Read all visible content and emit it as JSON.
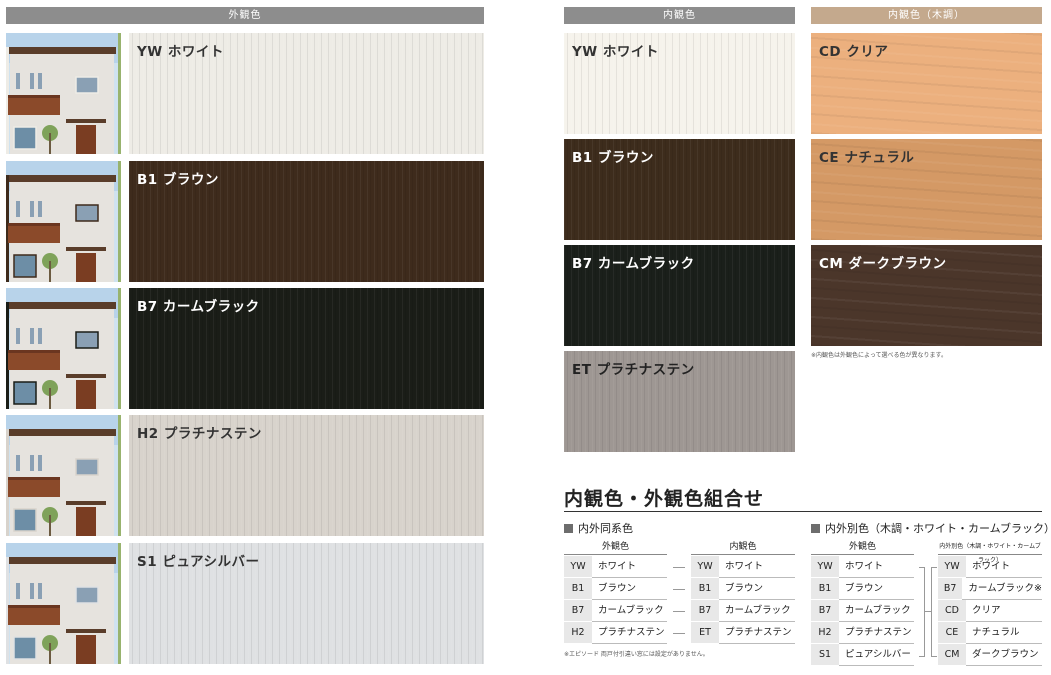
{
  "headers": {
    "exterior": "外観色",
    "interior": "内観色",
    "interior_wood": "内観色（木調）"
  },
  "exterior_swatches": [
    {
      "label": "YW ホワイト",
      "color": "#eeece6",
      "text_color": "#333333"
    },
    {
      "label": "B1 ブラウン",
      "color": "#3e2b1c",
      "text_color": "#ffffff"
    },
    {
      "label": "B7 カームブラック",
      "color": "#1a1d17",
      "text_color": "#ffffff"
    },
    {
      "label": "H2 プラチナステン",
      "color": "#d8d3cc",
      "text_color": "#333333"
    },
    {
      "label": "S1 ピュアシルバー",
      "color": "#dfe1e3",
      "text_color": "#333333"
    }
  ],
  "interior_swatches": [
    {
      "label": "YW ホワイト",
      "color": "#f6f3ec",
      "text_color": "#333333"
    },
    {
      "label": "B1 ブラウン",
      "color": "#3d2c1c",
      "text_color": "#ffffff"
    },
    {
      "label": "B7 カームブラック",
      "color": "#1a1f1a",
      "text_color": "#ffffff"
    },
    {
      "label": "ET プラチナステン",
      "color": "#9e9793",
      "text_color": "#222222"
    }
  ],
  "wood_swatches": [
    {
      "label": "CD クリア",
      "color": "#ecb07e",
      "text_color": "#333333"
    },
    {
      "label": "CE ナチュラル",
      "color": "#d49965",
      "text_color": "#333333"
    },
    {
      "label": "CM ダークブラウン",
      "color": "#4b362a",
      "text_color": "#ffffff"
    }
  ],
  "wood_note": "※内観色は外観色によって選べる色が異なります。",
  "combination": {
    "title": "内観色・外観色組合せ",
    "same_system": {
      "title": "内外同系色",
      "col_exterior": "外観色",
      "col_interior": "内観色",
      "exterior_rows": [
        {
          "code": "YW",
          "name": "ホワイト"
        },
        {
          "code": "B1",
          "name": "ブラウン"
        },
        {
          "code": "B7",
          "name": "カームブラック"
        },
        {
          "code": "H2",
          "name": "プラチナステン"
        }
      ],
      "interior_rows": [
        {
          "code": "YW",
          "name": "ホワイト"
        },
        {
          "code": "B1",
          "name": "ブラウン"
        },
        {
          "code": "B7",
          "name": "カームブラック"
        },
        {
          "code": "ET",
          "name": "プラチナステン"
        }
      ],
      "note": "※エピソード 両戸付引違い窓には設定がありません。"
    },
    "different": {
      "title": "内外別色（木調・ホワイト・カームブラック）",
      "col_exterior": "外観色",
      "col_interior": "内外別色（木調・ホワイト・カームブラック）",
      "exterior_rows": [
        {
          "code": "YW",
          "name": "ホワイト"
        },
        {
          "code": "B1",
          "name": "ブラウン"
        },
        {
          "code": "B7",
          "name": "カームブラック"
        },
        {
          "code": "H2",
          "name": "プラチナステン"
        },
        {
          "code": "S1",
          "name": "ピュアシルバー"
        }
      ],
      "interior_rows": [
        {
          "code": "YW",
          "name": "ホワイト"
        },
        {
          "code": "B7",
          "name": "カームブラック※"
        },
        {
          "code": "CD",
          "name": "クリア"
        },
        {
          "code": "CE",
          "name": "ナチュラル"
        },
        {
          "code": "CM",
          "name": "ダークブラウン"
        }
      ]
    }
  }
}
